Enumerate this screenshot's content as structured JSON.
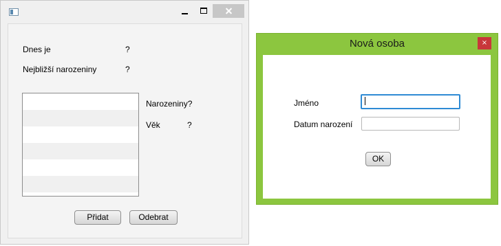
{
  "main_window": {
    "today_label": "Dnes je",
    "today_value": "?",
    "nearest_label": "Nejbližší narozeniny",
    "nearest_value": "?",
    "birthday_label": "Narozeniny?",
    "age_label": "Věk",
    "age_value": "?",
    "add_button": "Přidat",
    "remove_button": "Odebrat",
    "list_rows": [
      "",
      "",
      "",
      "",
      "",
      ""
    ]
  },
  "dialog": {
    "title": "Nová osoba",
    "close_glyph": "×",
    "name_label": "Jméno",
    "name_value": "",
    "birthdate_label": "Datum narození",
    "birthdate_value": "",
    "ok_button": "OK",
    "accent_color": "#8cc63f",
    "close_color": "#c8373a"
  }
}
